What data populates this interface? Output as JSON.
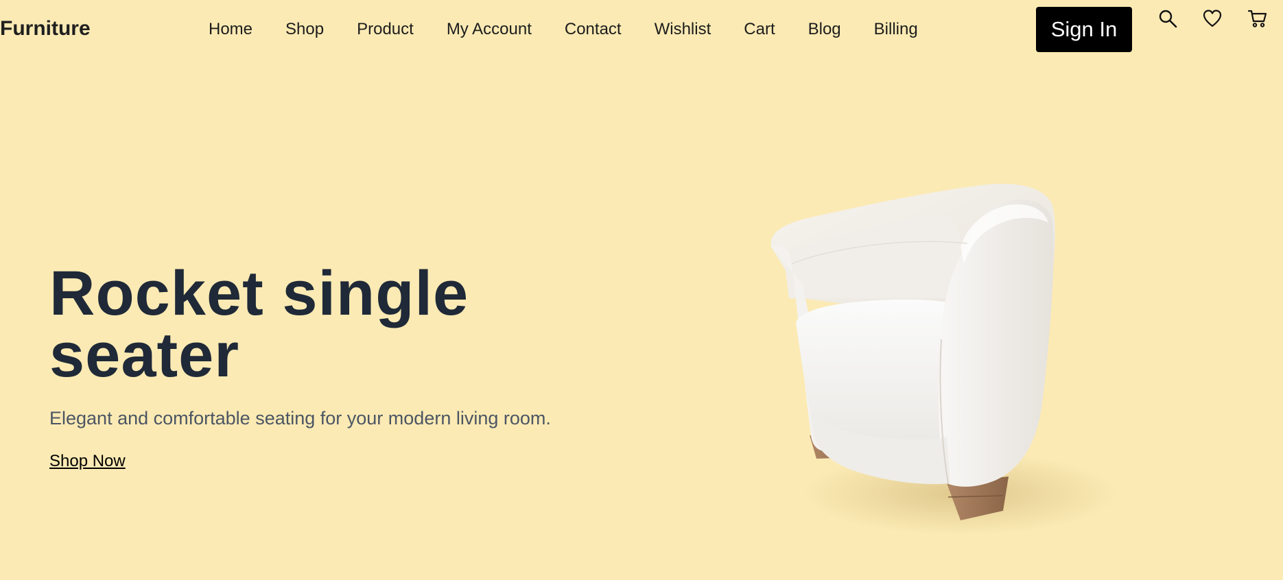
{
  "brand": {
    "name": "Furniture"
  },
  "nav": {
    "items": [
      {
        "label": "Home",
        "icon": ""
      },
      {
        "label": "Shop"
      },
      {
        "label": "Product"
      },
      {
        "label": "My Account"
      },
      {
        "label": "Contact"
      },
      {
        "label": "Wishlist"
      },
      {
        "label": "Cart"
      },
      {
        "label": "Blog"
      },
      {
        "label": "Billing"
      }
    ]
  },
  "header": {
    "signin_label": "Sign In",
    "icons": [
      "search-icon",
      "heart-icon",
      "cart-icon"
    ]
  },
  "hero": {
    "title": "Rocket single seater",
    "subtitle": "Elegant and comfortable seating for your modern living room.",
    "cta_label": "Shop Now",
    "image": "white-armchair"
  },
  "colors": {
    "hero_background": "#fbeab4",
    "title": "#1f2937",
    "subtitle": "#4b5563",
    "button_background": "#000000",
    "button_text": "#ffffff"
  }
}
